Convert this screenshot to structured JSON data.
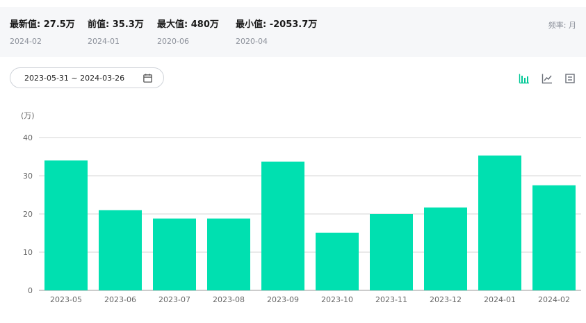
{
  "stats": [
    {
      "label": "最新值: 27.5万",
      "date": "2024-02"
    },
    {
      "label": "前值: 35.3万",
      "date": "2024-01"
    },
    {
      "label": "最大值: 480万",
      "date": "2020-06"
    },
    {
      "label": "最小值: -2053.7万",
      "date": "2020-04"
    }
  ],
  "frequency": "频率: 月",
  "date_range": "2023-05-31 ~ 2024-03-26",
  "icons": {
    "calendar": "calendar-icon",
    "bar": "bar-chart-icon",
    "line": "line-chart-icon",
    "table": "table-icon"
  },
  "colors": {
    "bar": "#00e0b0",
    "active_icon": "#00c896",
    "inactive_icon": "#6b7079"
  },
  "chart_data": {
    "type": "bar",
    "unit_label": "(万)",
    "categories": [
      "2023-05",
      "2023-06",
      "2023-07",
      "2023-08",
      "2023-09",
      "2023-10",
      "2023-11",
      "2023-12",
      "2024-01",
      "2024-02"
    ],
    "values": [
      34,
      21,
      18.8,
      18.8,
      33.7,
      15.1,
      20,
      21.7,
      35.3,
      27.5
    ],
    "ylim": [
      0,
      40
    ],
    "yticks": [
      0,
      10,
      20,
      30,
      40
    ],
    "grid": true
  }
}
